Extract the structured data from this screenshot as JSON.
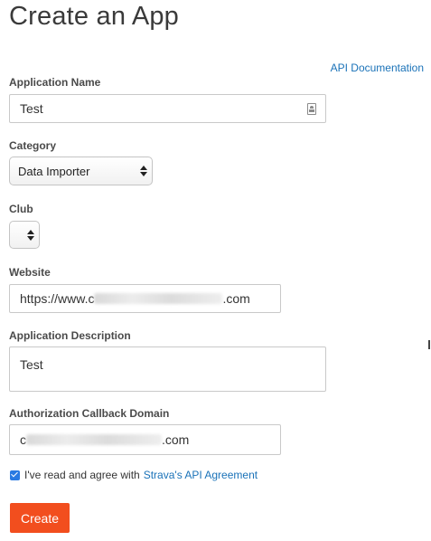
{
  "page": {
    "title": "Create an App"
  },
  "links": {
    "api_documentation": "API Documentation"
  },
  "fields": {
    "application_name": {
      "label": "Application Name",
      "value": "Test"
    },
    "category": {
      "label": "Category",
      "selected": "Data Importer"
    },
    "club": {
      "label": "Club",
      "selected": ""
    },
    "website": {
      "label": "Website",
      "value_prefix": "https://www.c",
      "value_suffix": ".com"
    },
    "description": {
      "label": "Application Description",
      "value": "Test"
    },
    "callback_domain": {
      "label": "Authorization Callback Domain",
      "value_prefix": "c",
      "value_suffix": ".com"
    }
  },
  "agreement": {
    "checked": true,
    "text": "I've read and agree with",
    "link": "Strava's API Agreement"
  },
  "actions": {
    "create_label": "Create"
  },
  "colors": {
    "accent": "#f24e1e",
    "link": "#1a72b8",
    "checkbox": "#2a7ae2"
  },
  "icons": {
    "name_field": "contact-card-icon",
    "select": "updown-arrows-icon",
    "agree": "checkbox-checked-icon"
  }
}
